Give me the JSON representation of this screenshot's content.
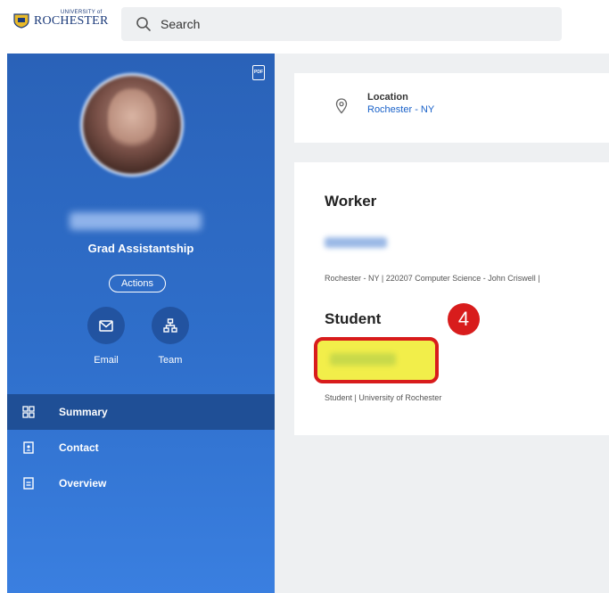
{
  "header": {
    "logo_small": "UNIVERSITY of",
    "logo_big": "ROCHESTER",
    "search_placeholder": "Search"
  },
  "profile": {
    "pdf_label": "PDF",
    "job_title": "Grad Assistantship",
    "actions_label": "Actions",
    "quick_actions": [
      {
        "label": "Email",
        "icon": "envelope-icon"
      },
      {
        "label": "Team",
        "icon": "org-chart-icon"
      }
    ]
  },
  "nav": {
    "items": [
      {
        "label": "Summary",
        "icon": "grid-icon",
        "active": true
      },
      {
        "label": "Contact",
        "icon": "contact-card-icon",
        "active": false
      },
      {
        "label": "Overview",
        "icon": "document-icon",
        "active": false
      }
    ]
  },
  "location": {
    "label": "Location",
    "value": "Rochester - NY"
  },
  "worker": {
    "title": "Worker",
    "detail": "Rochester - NY | 220207 Computer Science - John Criswell |"
  },
  "student": {
    "title": "Student",
    "detail": "Student | University of Rochester"
  },
  "annotation": {
    "step_number": "4",
    "highlight_color": "#f2ee4a",
    "marker_color": "#d81c1c"
  },
  "colors": {
    "sidebar_blue": "#2f6fcb",
    "link_blue": "#1a62c9",
    "background_gray": "#eef0f2"
  }
}
